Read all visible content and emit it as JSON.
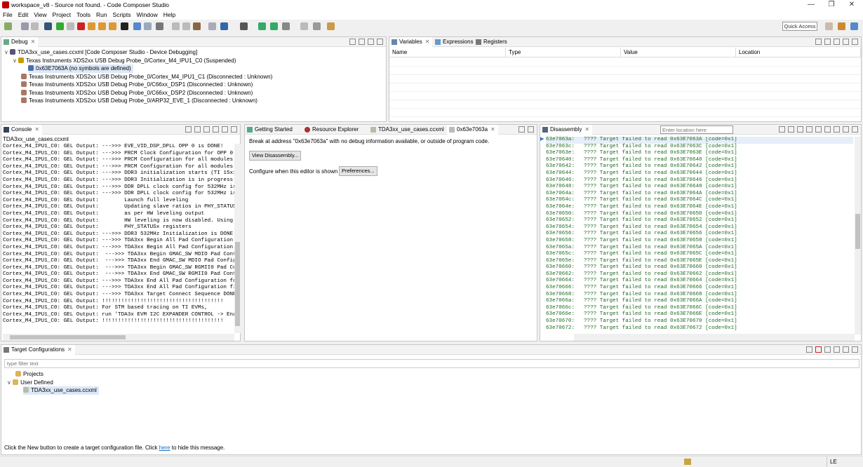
{
  "window": {
    "title": "workspace_v8 - Source not found. - Code Composer Studio"
  },
  "menu": [
    "File",
    "Edit",
    "View",
    "Project",
    "Tools",
    "Run",
    "Scripts",
    "Window",
    "Help"
  ],
  "toolbar": {
    "quick_access": "Quick Access"
  },
  "debug": {
    "tab": "Debug",
    "items": [
      {
        "label": "TDA3xx_use_cases.ccxml [Code Composer Studio - Device Debugging]",
        "icon": "debug-config-icon"
      },
      {
        "label": "Texas Instruments XDS2xx USB Debug Probe_0/Cortex_M4_IPU1_C0 (Suspended)",
        "icon": "core-suspended-icon"
      },
      {
        "label": "0x63E7063A  (no symbols are defined)",
        "icon": "stack-frame-icon"
      },
      {
        "label": "Texas Instruments XDS2xx USB Debug Probe_0/Cortex_M4_IPU1_C1 (Disconnected : Unknown)",
        "icon": "core-disconnected-icon"
      },
      {
        "label": "Texas Instruments XDS2xx USB Debug Probe_0/C66xx_DSP1 (Disconnected : Unknown)",
        "icon": "core-disconnected-icon"
      },
      {
        "label": "Texas Instruments XDS2xx USB Debug Probe_0/C66xx_DSP2 (Disconnected : Unknown)",
        "icon": "core-disconnected-icon"
      },
      {
        "label": "Texas Instruments XDS2xx USB Debug Probe_0/ARP32_EVE_1 (Disconnected : Unknown)",
        "icon": "core-disconnected-icon"
      }
    ]
  },
  "variables": {
    "tabs": [
      "Variables",
      "Expressions",
      "Registers"
    ],
    "columns": [
      "Name",
      "Type",
      "Value",
      "Location"
    ]
  },
  "console": {
    "tab": "Console",
    "subtitle": "TDA3xx_use_cases.ccxml",
    "lines": [
      "Cortex_M4_IPU1_C0: GEL Output: --->>> EVE_VID_DSP_DPLL OPP 0 is DONE!",
      "Cortex_M4_IPU1_C0: GEL Output: --->>> PRCM Clock Configuration for OPP 0 i",
      "Cortex_M4_IPU1_C0: GEL Output: --->>> PRCM Configuration for all modules i",
      "Cortex_M4_IPU1_C0: GEL Output: --->>> PRCM Configuration for all modules i",
      "Cortex_M4_IPU1_C0: GEL Output: --->>> DDR3 initialization starts (TI 15x15",
      "Cortex_M4_IPU1_C0: GEL Output: --->>> DDR3 Initialization is in progress .",
      "Cortex_M4_IPU1_C0: GEL Output: --->>> DDR DPLL clock config for 532MHz is",
      "Cortex_M4_IPU1_C0: GEL Output: --->>> DDR DPLL clock config for 532MHz is",
      "Cortex_M4_IPU1_C0: GEL Output:        Launch full leveling",
      "Cortex_M4_IPU1_C0: GEL Output:        Updating slave ratios in PHY_STATUSx",
      "Cortex_M4_IPU1_C0: GEL Output:        as per HW leveling output",
      "Cortex_M4_IPU1_C0: GEL Output:        HW leveling is now disabled. Using s",
      "Cortex_M4_IPU1_C0: GEL Output:        PHY_STATUSx registers",
      "Cortex_M4_IPU1_C0: GEL Output: --->>> DDR3 532MHz Initialization is DONE!",
      "Cortex_M4_IPU1_C0: GEL Output: --->>> TDA3xx Begin All Pad Configuration f",
      "Cortex_M4_IPU1_C0: GEL Output: --->>> TDA3xx Begin All Pad Configuration f",
      "Cortex_M4_IPU1_C0: GEL Output:  --->>> TDA3xx Begin GMAC_SW MDIO Pad Confi",
      "Cortex_M4_IPU1_C0: GEL Output:  --->>> TDA3xx End GMAC_SW MDIO Pad Configu",
      "Cortex_M4_IPU1_C0: GEL Output:  --->>> TDA3xx Begin GMAC_SW RGMII0 Pad Cor",
      "Cortex_M4_IPU1_C0: GEL Output:  --->>> TDA3xx End GMAC_SW RGMII0 Pad Confi",
      "Cortex_M4_IPU1_C0: GEL Output: --->>> TDA3xx End All Pad Configuration for",
      "Cortex_M4_IPU1_C0: GEL Output: --->>> TDA3xx End All Pad Configuration fi",
      "Cortex_M4_IPU1_C0: GEL Output: --->>> TDA3xx Target Connect Sequence DONE",
      "Cortex_M4_IPU1_C0: GEL Output: !!!!!!!!!!!!!!!!!!!!!!!!!!!!!!!!!!!!!!",
      "Cortex_M4_IPU1_C0: GEL Output: For STM based tracing on TI EVMs,",
      "Cortex_M4_IPU1_C0: GEL Output: run 'TDA3x EVM I2C EXPANDER CONTROL -> Enab",
      "Cortex_M4_IPU1_C0: GEL Output: !!!!!!!!!!!!!!!!!!!!!!!!!!!!!!!!!!!!!!"
    ]
  },
  "editor": {
    "tabs": [
      "Getting Started",
      "Resource Explorer",
      "TDA3xx_use_cases.ccxml",
      "0x63e7063a"
    ],
    "message": "Break at address \"0x63e7063a\" with no debug information available, or outside of program code.",
    "view_disassembly": "View Disassembly...",
    "configure_text": "Configure when this editor is shown",
    "preferences": "Preferences..."
  },
  "disassembly": {
    "tab": "Disassembly",
    "location_placeholder": "Enter location here",
    "rows": [
      {
        "addr": "63e7063a:",
        "text": "???? Target failed to read 0x63E7063A [code=0x1]"
      },
      {
        "addr": "63e7063c:",
        "text": "???? Target failed to read 0x63E7063C [code=0x1]"
      },
      {
        "addr": "63e7063e:",
        "text": "???? Target failed to read 0x63E7063E [code=0x1]"
      },
      {
        "addr": "63e70640:",
        "text": "???? Target failed to read 0x63E70640 [code=0x1]"
      },
      {
        "addr": "63e70642:",
        "text": "???? Target failed to read 0x63E70642 [code=0x1]"
      },
      {
        "addr": "63e70644:",
        "text": "???? Target failed to read 0x63E70644 [code=0x1]"
      },
      {
        "addr": "63e70646:",
        "text": "???? Target failed to read 0x63E70646 [code=0x1]"
      },
      {
        "addr": "63e70648:",
        "text": "???? Target failed to read 0x63E70648 [code=0x1]"
      },
      {
        "addr": "63e7064a:",
        "text": "???? Target failed to read 0x63E7064A [code=0x1]"
      },
      {
        "addr": "63e7064c:",
        "text": "???? Target failed to read 0x63E7064C [code=0x1]"
      },
      {
        "addr": "63e7064e:",
        "text": "???? Target failed to read 0x63E7064E [code=0x1]"
      },
      {
        "addr": "63e70650:",
        "text": "???? Target failed to read 0x63E70650 [code=0x1]"
      },
      {
        "addr": "63e70652:",
        "text": "???? Target failed to read 0x63E70652 [code=0x1]"
      },
      {
        "addr": "63e70654:",
        "text": "???? Target failed to read 0x63E70654 [code=0x1]"
      },
      {
        "addr": "63e70656:",
        "text": "???? Target failed to read 0x63E70656 [code=0x1]"
      },
      {
        "addr": "63e70658:",
        "text": "???? Target failed to read 0x63E70658 [code=0x1]"
      },
      {
        "addr": "63e7065a:",
        "text": "???? Target failed to read 0x63E7065A [code=0x1]"
      },
      {
        "addr": "63e7065c:",
        "text": "???? Target failed to read 0x63E7065C [code=0x1]"
      },
      {
        "addr": "63e7065e:",
        "text": "???? Target failed to read 0x63E7065E [code=0x1]"
      },
      {
        "addr": "63e70660:",
        "text": "???? Target failed to read 0x63E70660 [code=0x1]"
      },
      {
        "addr": "63e70662:",
        "text": "???? Target failed to read 0x63E70662 [code=0x1]"
      },
      {
        "addr": "63e70664:",
        "text": "???? Target failed to read 0x63E70664 [code=0x1]"
      },
      {
        "addr": "63e70666:",
        "text": "???? Target failed to read 0x63E70666 [code=0x1]"
      },
      {
        "addr": "63e70668:",
        "text": "???? Target failed to read 0x63E70668 [code=0x1]"
      },
      {
        "addr": "63e7066a:",
        "text": "???? Target failed to read 0x63E7066A [code=0x1]"
      },
      {
        "addr": "63e7066c:",
        "text": "???? Target failed to read 0x63E7066C [code=0x1]"
      },
      {
        "addr": "63e7066e:",
        "text": "???? Target failed to read 0x63E7066E [code=0x1]"
      },
      {
        "addr": "63e70670:",
        "text": "???? Target failed to read 0x63E70670 [code=0x1]"
      },
      {
        "addr": "63e70672:",
        "text": "???? Target failed to read 0x63E70672 [code=0x1]"
      }
    ]
  },
  "target_configs": {
    "tab": "Target Configurations",
    "filter_placeholder": "type filter text",
    "items": [
      {
        "label": "Projects",
        "icon": "folder-icon"
      },
      {
        "label": "User Defined",
        "icon": "folder-open-icon"
      },
      {
        "label": "TDA3xx_use_cases.ccxml",
        "icon": "ccxml-file-icon"
      }
    ],
    "hint_before": "Click the New button to create a target configuration file. Click ",
    "hint_link": "here",
    "hint_after": " to hide this message."
  },
  "status": {
    "insert_mode": "LE"
  },
  "colors": {
    "accent": "#1a6fc9",
    "disasm_text": "#1f6b20",
    "selection": "#dde8f8"
  }
}
